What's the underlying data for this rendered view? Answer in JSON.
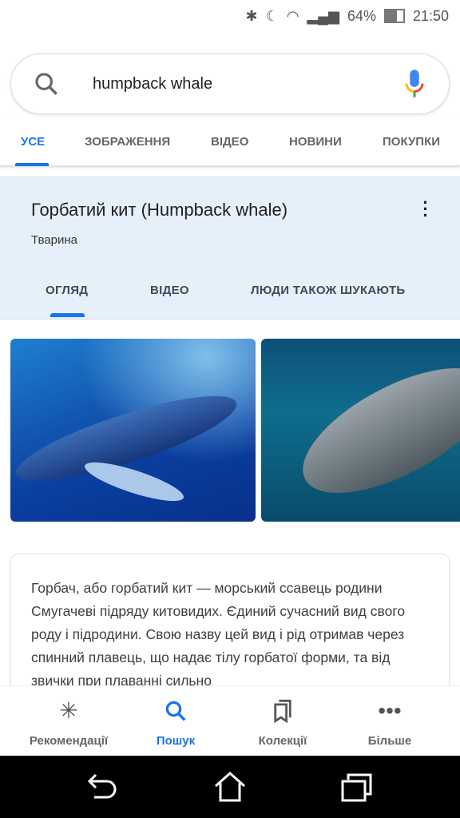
{
  "status": {
    "battery": "64%",
    "time": "21:50",
    "icons": [
      "bluetooth-icon",
      "moon-icon",
      "wifi-icon",
      "signal-icon",
      "battery-icon"
    ]
  },
  "search": {
    "query": "humpback whale"
  },
  "tabs": [
    "УСЕ",
    "ЗОБРАЖЕННЯ",
    "ВІДЕО",
    "НОВИНИ",
    "ПОКУПКИ"
  ],
  "knowledge": {
    "title": "Горбатий кит (Humpback whale)",
    "subtitle": "Тварина",
    "more": "⋮",
    "tabs": [
      "ОГЛЯД",
      "ВІДЕО",
      "ЛЮДИ ТАКОЖ ШУКАЮТЬ"
    ]
  },
  "description": "Горбач, або горбатий кит — морський ссавець родини Смугачеві підряду китовидих. Єдиний сучасний вид свого роду і підродини. Свою назву цей вид і рід отримав через спинний плавець, що надає тілу горбатої форми, та від звички при плаванні сильно",
  "nav": [
    {
      "label": "Рекомендації",
      "icon": "asterisk-icon"
    },
    {
      "label": "Пошук",
      "icon": "search-icon"
    },
    {
      "label": "Колекції",
      "icon": "collections-icon"
    },
    {
      "label": "Більше",
      "icon": "more-icon"
    }
  ],
  "colors": {
    "accent": "#1a73e8",
    "panel": "#e6f0fb"
  }
}
